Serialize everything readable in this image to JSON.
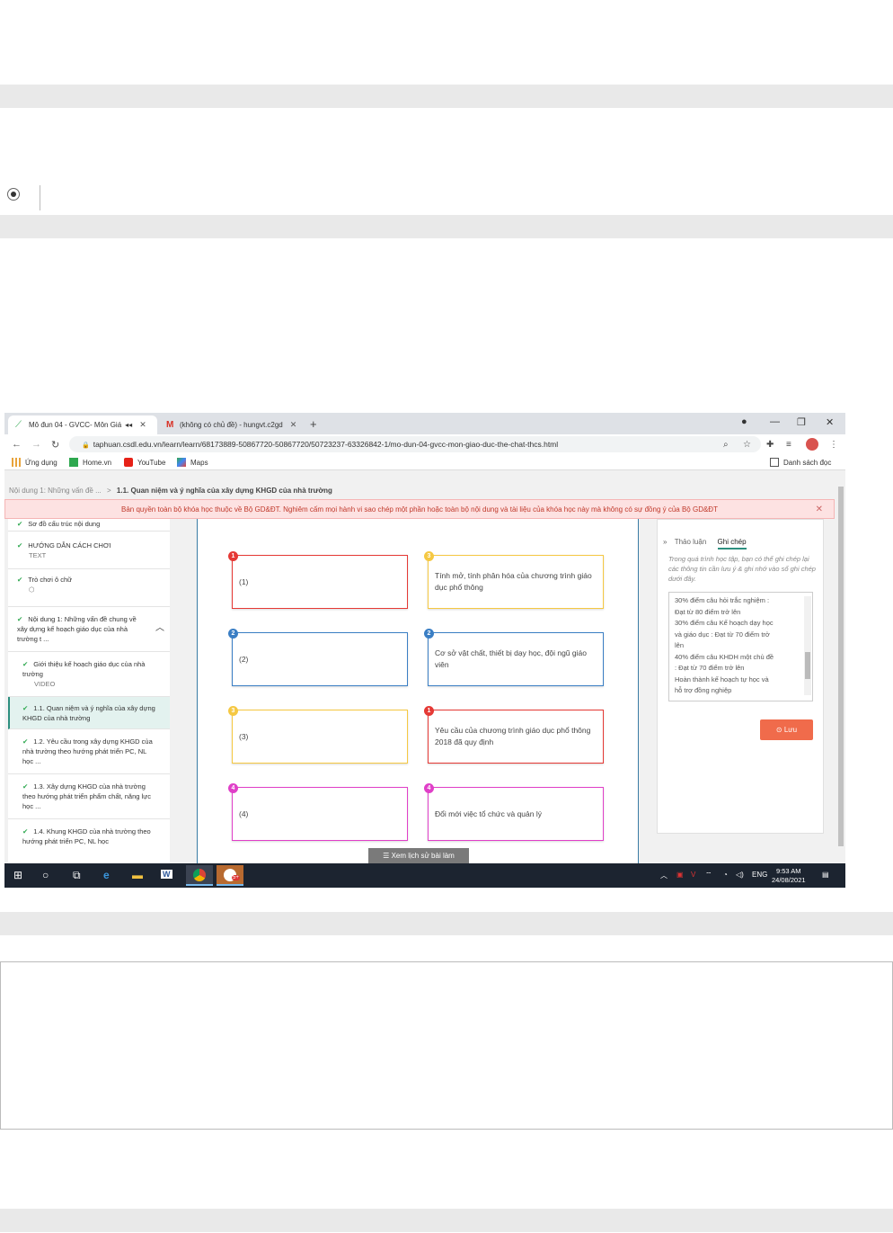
{
  "browser": {
    "tabs": [
      {
        "title": "Mô đun 04 - GVCC- Môn Giá",
        "audio_icon": "speaker-icon",
        "active": true
      },
      {
        "title": "(không có chủ đề) - hungvt.c2gd",
        "active": false
      }
    ],
    "url": "taphuan.csdl.edu.vn/learn/learn/68173889-50867720-50867720/50723237-63326842-1/mo-dun-04-gvcc-mon-giao-duc-the-chat-thcs.html",
    "bookmarks": [
      {
        "label": "Ứng dụng",
        "icon": "apps-grid-icon"
      },
      {
        "label": "Home.vn",
        "icon": "homevn-icon"
      },
      {
        "label": "YouTube",
        "icon": "youtube-icon"
      },
      {
        "label": "Maps",
        "icon": "maps-icon"
      }
    ],
    "reading_list": "Danh sách đọc"
  },
  "page": {
    "breadcrumb_parent": "Nội dung 1: Những vấn đề ...",
    "breadcrumb_sep": ">",
    "breadcrumb_current": "1.1. Quan niệm và ý nghĩa của xây dựng KHGD của nhà trường",
    "notice": "Bản quyền toàn bộ khóa học thuộc về Bộ GD&ĐT. Nghiêm cấm mọi hành vi sao chép một phần hoặc toàn bộ nội dung và tài liệu của khóa học này mà không có sự đồng ý của Bộ GD&ĐT",
    "sidebar": [
      {
        "label": "Sơ đồ cấu trúc nội dung",
        "sub": ""
      },
      {
        "label": "HƯỚNG DẪN CÁCH CHƠI",
        "sub": "TEXT"
      },
      {
        "label": "Trò chơi ô chữ",
        "sub": ""
      },
      {
        "label": "Nội dung 1: Những vấn đề chung về xây dựng kế hoạch giáo dục của nhà trường t ...",
        "sub": ""
      },
      {
        "label": "Giới thiệu kế hoạch giáo dục của nhà trường",
        "sub": "VIDEO"
      },
      {
        "label": "1.1. Quan niệm và ý nghĩa của xây dựng KHGD của nhà trường",
        "sub": ""
      },
      {
        "label": "1.2. Yêu cầu trong xây dựng KHGD của nhà trường theo hướng phát triển PC, NL học ...",
        "sub": ""
      },
      {
        "label": "1.3. Xây dựng KHGD của nhà trường theo hướng phát triển phẩm chất, năng lực học ...",
        "sub": ""
      },
      {
        "label": "1.4. Khung KHGD của nhà trường theo hướng phát triển PC, NL học",
        "sub": ""
      }
    ],
    "matching": {
      "left": [
        {
          "badge": "1",
          "text": "(1)",
          "color": "#e53935"
        },
        {
          "badge": "2",
          "text": "(2)",
          "color": "#3a7ec4"
        },
        {
          "badge": "3",
          "text": "(3)",
          "color": "#f5c842"
        },
        {
          "badge": "4",
          "text": "(4)",
          "color": "#e040c8"
        }
      ],
      "right": [
        {
          "badge": "3",
          "text": "Tính mở, tính phân hóa của chương trình giáo dục phổ thông",
          "color": "#f5c842"
        },
        {
          "badge": "2",
          "text": "Cơ sở vật chất, thiết bị dạy học, đội ngũ giáo viên",
          "color": "#3a7ec4"
        },
        {
          "badge": "1",
          "text": "Yêu cầu của chương trình giáo dục phổ thông 2018 đã quy định",
          "color": "#e53935"
        },
        {
          "badge": "4",
          "text": "Đổi mới việc tổ chức và quản lý",
          "color": "#e040c8"
        }
      ]
    },
    "notes": {
      "tab_discussion": "Thảo luận",
      "tab_notes": "Ghi chép",
      "hint": "Trong quá trình học tập, bạn có thể ghi chép lại các thông tin cần lưu ý & ghi nhớ vào sổ ghi chép dưới đây.",
      "lines": [
        "30% điểm câu hỏi trắc nghiệm :",
        "Đạt từ 80 điểm trở lên",
        "30% điểm câu Kế hoạch dạy học",
        "và giáo dục : Đạt từ 70 điểm trở",
        "lên",
        "40% điểm câu KHDH một chủ đề",
        ": Đạt từ 70 điểm trở lên",
        " Hoàn thành kế hoạch tự học và",
        "hỗ trợ đồng nghiệp"
      ],
      "save_label": "Lưu"
    },
    "history_button": "Xem lịch sử bài làm"
  },
  "taskbar": {
    "lang": "ENG",
    "time": "9:53 AM",
    "date": "24/08/2021",
    "notif_count": "5+"
  }
}
